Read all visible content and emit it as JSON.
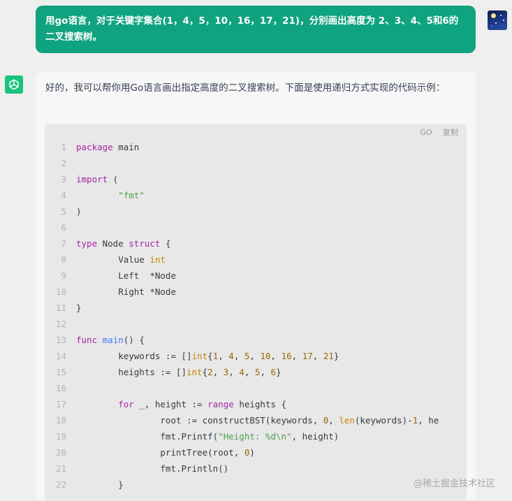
{
  "user_message": "用go语言，对于关键字集合(1，4，5，10，16，17，21)，分别画出高度为 2、3、4、5和6的二叉搜索树。",
  "assistant_message": "好的，我可以帮你用Go语言画出指定高度的二叉搜索树。下面是使用递归方式实现的代码示例：",
  "code_block": {
    "language_label": "GO",
    "copy_label": "复制",
    "line_numbers": [
      "1",
      "2",
      "3",
      "4",
      "5",
      "6",
      "7",
      "8",
      "9",
      "10",
      "11",
      "12",
      "13",
      "14",
      "15",
      "16",
      "17",
      "18",
      "19",
      "20",
      "21",
      "22"
    ],
    "lines": [
      "package main",
      "",
      "import (",
      "        \"fmt\"",
      ")",
      "",
      "type Node struct {",
      "        Value int",
      "        Left  *Node",
      "        Right *Node",
      "}",
      "",
      "func main() {",
      "        keywords := []int{1, 4, 5, 10, 16, 17, 21}",
      "        heights := []int{2, 3, 4, 5, 6}",
      "",
      "        for _, height := range heights {",
      "                root := constructBST(keywords, 0, len(keywords)-1, he",
      "                fmt.Printf(\"Height: %d\\n\", height)",
      "                printTree(root, 0)",
      "                fmt.Println()",
      "        }"
    ]
  },
  "watermark": "@稀土掘金技术社区",
  "colors": {
    "user_bubble": "#10a37f",
    "bot_avatar": "#19c37d",
    "keyword": "#a626a4",
    "type": "#c18401",
    "string": "#50a14f",
    "number": "#986801",
    "function": "#4078f2"
  },
  "icons": {
    "user_avatar": "night-sky-avatar-icon",
    "bot_avatar": "openai-logo-icon"
  }
}
